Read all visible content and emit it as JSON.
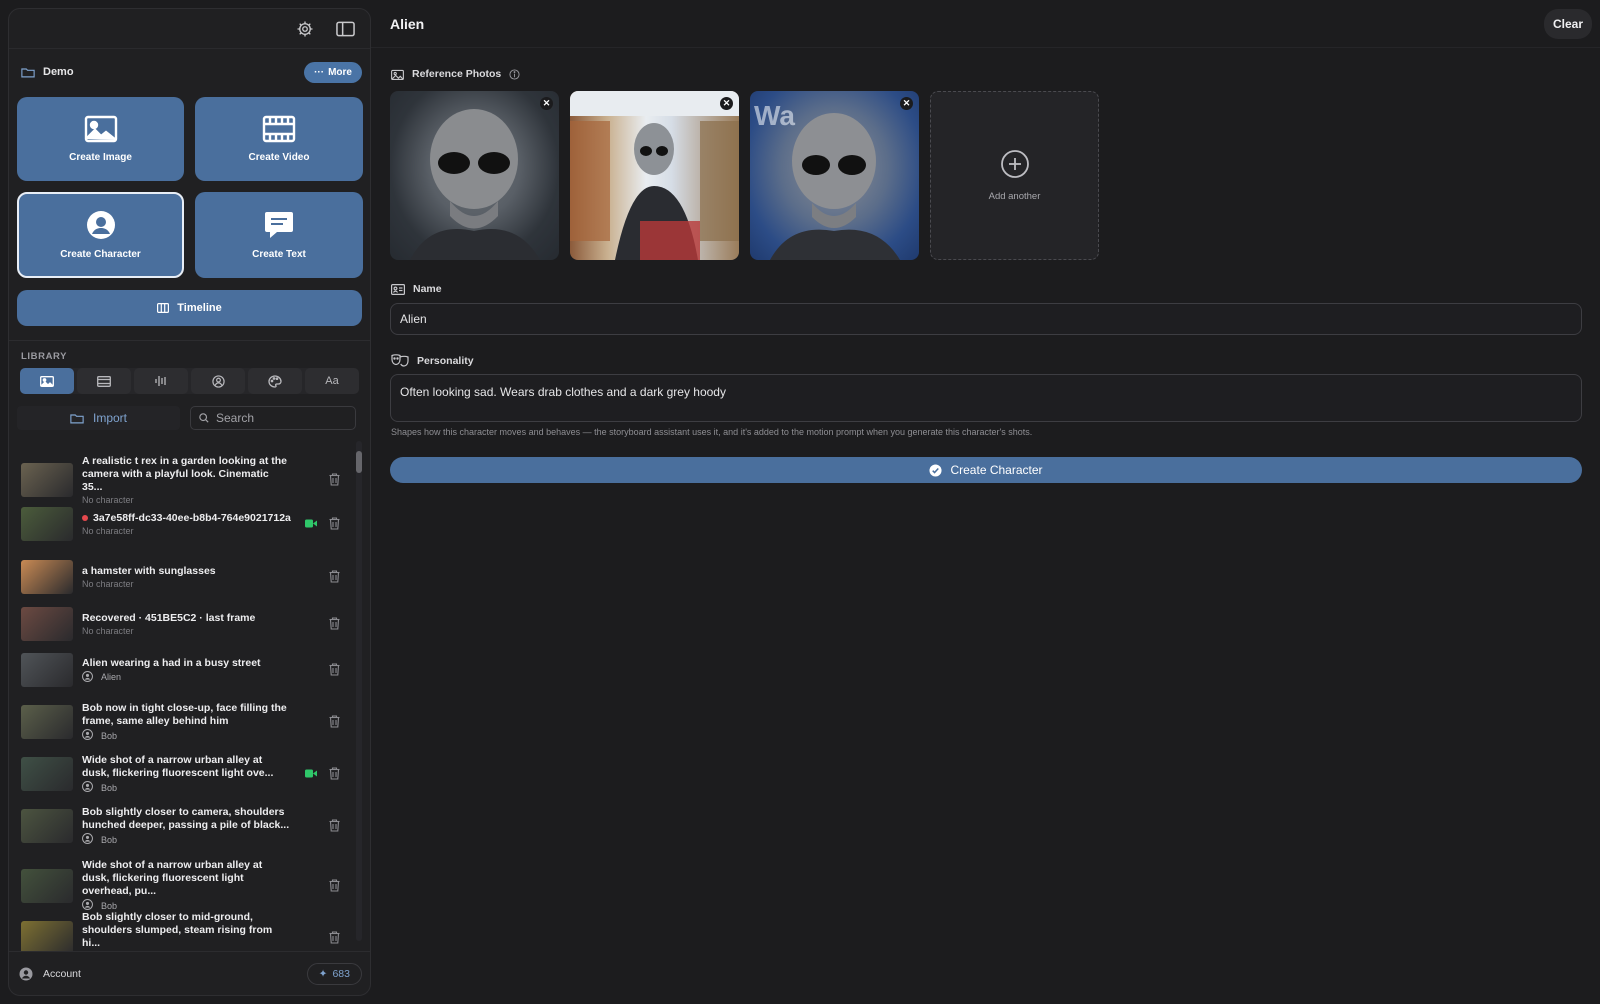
{
  "sidebar": {
    "project_name": "Demo",
    "more_label": "More",
    "tiles": [
      {
        "label": "Create Image",
        "icon": "image-icon"
      },
      {
        "label": "Create Video",
        "icon": "film-icon"
      },
      {
        "label": "Create Character",
        "icon": "person-icon"
      },
      {
        "label": "Create Text",
        "icon": "chat-icon"
      }
    ],
    "timeline_label": "Timeline",
    "library_label": "LIBRARY",
    "library_tabs": [
      "image-icon",
      "film-icon",
      "audio-icon",
      "person-icon",
      "palette-icon",
      "Aa"
    ],
    "import_label": "Import",
    "search_placeholder": "Search",
    "items": [
      {
        "title": "A realistic t rex in a garden looking at the camera with a playful look. Cinematic 35...",
        "sub": "No character",
        "thumb": "#6a6250"
      },
      {
        "title": "3a7e58ff-dc33-40ee-b8b4-764e9021712a",
        "sub": "No character",
        "thumb": "#4b5c3b",
        "video": true,
        "recording": true
      },
      {
        "title": "a hamster with sunglasses",
        "sub": "No character",
        "thumb": "#c98a54"
      },
      {
        "title": "Recovered · 451BE5C2 · last frame",
        "sub": "No character",
        "thumb": "#6c4a42"
      },
      {
        "title": "Alien wearing a had in a busy street",
        "sub": "Alien",
        "thumb": "#505458",
        "character": true
      },
      {
        "title": "Bob now in tight close-up, face filling the frame, same alley behind him",
        "sub": "Bob",
        "thumb": "#5b5f4a",
        "character": true
      },
      {
        "title": "Wide shot of a narrow urban alley at dusk, flickering fluorescent light ove...",
        "sub": "Bob",
        "thumb": "#3f5046",
        "character": true,
        "video": true
      },
      {
        "title": "Bob slightly closer to camera, shoulders hunched deeper, passing a pile of black...",
        "sub": "Bob",
        "thumb": "#4c5440",
        "character": true
      },
      {
        "title": "Wide shot of a narrow urban alley at dusk, flickering fluorescent light overhead, pu...",
        "sub": "Bob",
        "thumb": "#43513c",
        "character": true
      },
      {
        "title": "Bob slightly closer to mid-ground, shoulders slumped, steam rising from hi...",
        "sub": "Bob",
        "thumb": "#7d7032",
        "character": true
      }
    ],
    "account_label": "Account",
    "credits": "683"
  },
  "main": {
    "title": "Alien",
    "clear_label": "Clear",
    "reference_label": "Reference Photos",
    "add_another_label": "Add another",
    "name_label": "Name",
    "name_value": "Alien",
    "personality_label": "Personality",
    "personality_value": "Often looking sad. Wears drab clothes and a dark grey hoody",
    "hint": "Shapes how this character moves and behaves — the storyboard assistant uses it, and it's added to the motion prompt when you generate this character's shots.",
    "create_label": "Create Character"
  },
  "colors": {
    "accent": "#4a6f9d",
    "record": "#e5484d",
    "video": "#2fc76a"
  }
}
